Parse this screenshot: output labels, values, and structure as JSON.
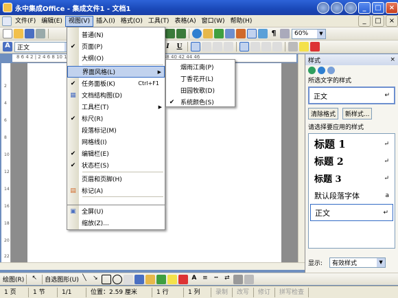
{
  "window": {
    "title": "永中集成Office - 集成文件1 - 文档1"
  },
  "menubar": [
    "文件(F)",
    "编辑(E)",
    "视图(V)",
    "插入(I)",
    "格式(O)",
    "工具(T)",
    "表格(A)",
    "窗口(W)",
    "帮助(H)"
  ],
  "toolbar": {
    "style_value": "正文",
    "zoom_value": "60%"
  },
  "ruler": {
    "text": "8  6  4  2  |  2   4   6   8  10  12  14  16  18  20  22  24  26  28  30  32  34  36  38  40  42  44  46"
  },
  "vruler": [
    "2",
    "4",
    "6",
    "8",
    "10",
    "12",
    "14",
    "16",
    "18",
    "20",
    "22"
  ],
  "view_menu": {
    "items": [
      {
        "label": "普通(N)",
        "checked": false
      },
      {
        "label": "页面(P)",
        "checked": true
      },
      {
        "label": "大纲(O)",
        "checked": false
      },
      {
        "label": "界面风格(L)",
        "checked": false,
        "submenu": true
      },
      {
        "label": "任务面板(K)",
        "checked": true,
        "shortcut": "Ctrl+F1"
      },
      {
        "label": "文档结构图(D)",
        "checked": false
      },
      {
        "label": "工具栏(T)",
        "checked": false,
        "submenu": true
      },
      {
        "label": "标尺(R)",
        "checked": true
      },
      {
        "label": "段落标记(M)",
        "checked": false
      },
      {
        "label": "网格线(I)",
        "checked": false
      },
      {
        "label": "编辑栏(E)",
        "checked": true
      },
      {
        "label": "状态栏(S)",
        "checked": true
      },
      {
        "label": "页眉和页脚(H)",
        "checked": false
      },
      {
        "label": "标记(A)",
        "checked": false
      },
      {
        "label": "全屏(U)",
        "checked": false
      },
      {
        "label": "缩放(Z)...",
        "checked": false
      }
    ]
  },
  "style_submenu": {
    "items": [
      {
        "label": "烟雨江南(P)",
        "checked": false
      },
      {
        "label": "丁香花开(L)",
        "checked": false
      },
      {
        "label": "田园牧歌(D)",
        "checked": false
      },
      {
        "label": "系统颜色(S)",
        "checked": true
      }
    ]
  },
  "taskpane": {
    "title": "样式",
    "current_label": "所选文字的样式",
    "current_style": "正文",
    "clear_btn": "清除格式",
    "new_btn": "新样式...",
    "apply_label": "请选择要应用的样式",
    "styles": [
      "标题 1",
      "标题 2",
      "标题 3",
      "默认段落字体",
      "正文"
    ],
    "style_marks": [
      "↵",
      "↵",
      "↵",
      "a",
      "↵"
    ],
    "show_label": "显示:",
    "show_value": "有效样式"
  },
  "drawbar": {
    "draw_label": "绘图(R)",
    "autoshape_label": "自选图形(U)"
  },
  "status": {
    "page": "1 页",
    "section": "1 节",
    "pages": "1/1",
    "position": "位置：2.59 厘米",
    "line": "1 行",
    "col": "1 列",
    "rec": "录制",
    "trk": "改写",
    "ext": "修订",
    "spell": "拼写检查"
  }
}
